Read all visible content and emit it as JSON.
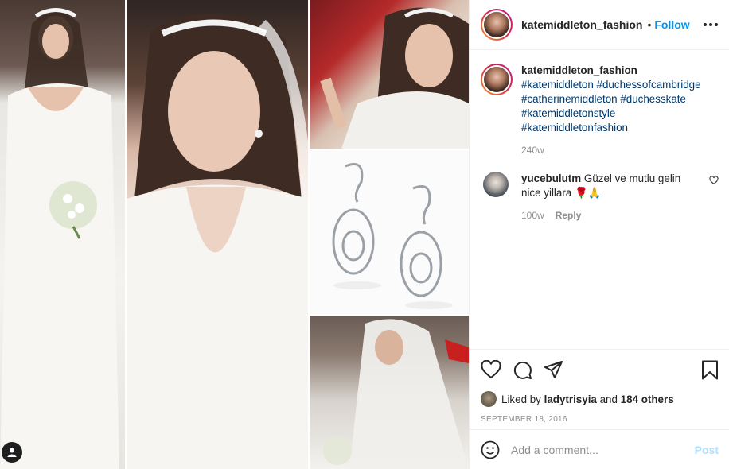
{
  "post": {
    "username": "katemiddleton_fashion",
    "follow_label": "Follow",
    "dot": "•"
  },
  "caption": {
    "username": "katemiddleton_fashion",
    "hashtags": [
      "#katemiddleton #duchessofcambridge",
      "#catherinemiddleton #duchesskate",
      "#katemiddletonstyle",
      "#katemiddletonfashion"
    ],
    "age": "240w"
  },
  "comment": {
    "username": "yucebulutm",
    "text": "Güzel ve mutlu gelin nice yillara 🌹🙏",
    "age": "100w",
    "reply_label": "Reply"
  },
  "likes": {
    "prefix": "Liked by",
    "user": "ladytrisyia",
    "and": "and",
    "others": "184 others"
  },
  "date": "SEPTEMBER 18, 2016",
  "add_comment": {
    "placeholder": "Add a comment...",
    "post_label": "Post"
  },
  "icons": {
    "header_more": "more-options-icon",
    "like": "heart-icon",
    "comment": "comment-bubble-icon",
    "share": "share-paper-plane-icon",
    "save": "bookmark-icon",
    "emoji": "emoji-smiley-icon",
    "tagged": "user-tag-icon"
  },
  "colors": {
    "link_blue": "#0095f6",
    "hashtag": "#00376b",
    "muted": "#8e8e8e",
    "post_disabled": "#b2dffc"
  }
}
